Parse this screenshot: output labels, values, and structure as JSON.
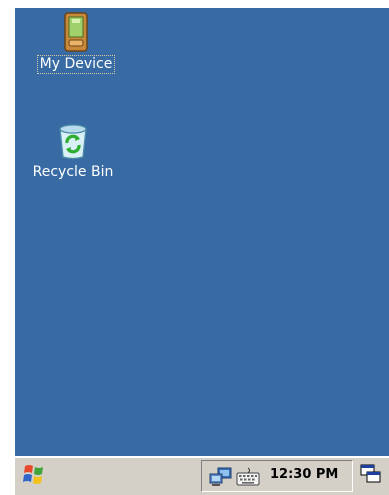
{
  "desktop": {
    "background_color": "#386aa3",
    "icons": [
      {
        "label": "My Device",
        "icon": "my-device-icon"
      },
      {
        "label": "Recycle Bin",
        "icon": "recycle-bin-icon"
      }
    ]
  },
  "taskbar": {
    "start_icon": "windows-flag-icon",
    "tray": {
      "icons": [
        "network-icon",
        "keyboard-icon"
      ],
      "clock": "12:30 PM"
    },
    "desktop_toggle_icon": "show-desktop-icon"
  }
}
